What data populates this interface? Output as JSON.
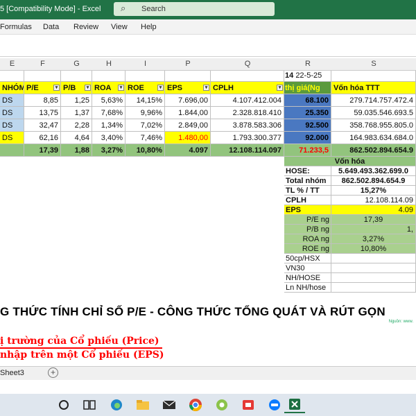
{
  "window": {
    "title": "5 [Compatibility Mode]  -  Excel",
    "search_placeholder": "Search"
  },
  "menu": [
    "Formulas",
    "Data",
    "Review",
    "View",
    "Help"
  ],
  "columns": [
    "E",
    "F",
    "G",
    "H",
    "I",
    "P",
    "Q",
    "R",
    "S"
  ],
  "top_row": {
    "num": "14",
    "date": "22-5-25"
  },
  "headers": [
    "NHÓM",
    "P/E",
    "P/B",
    "ROA",
    "ROE",
    "EPS",
    "CPLH",
    "thị giá(Ng",
    "Vốn hóa TTT"
  ],
  "rows": [
    [
      "DS",
      "8,85",
      "1,25",
      "5,63%",
      "14,15%",
      "7.696,00",
      "4.107.412.004",
      "68.100",
      "279.714.757.472.4"
    ],
    [
      "DS",
      "13,75",
      "1,37",
      "7,68%",
      "9,96%",
      "1.844,00",
      "2.328.818.410",
      "25.350",
      "59.035.546.693.5"
    ],
    [
      "DS",
      "32,47",
      "2,28",
      "1,34%",
      "7,02%",
      "2.849,00",
      "3.878.583.306",
      "92.500",
      "358.768.955.805.0"
    ],
    [
      "DS",
      "62,16",
      "4,64",
      "3,40%",
      "7,46%",
      "1.480,00",
      "1.793.300.377",
      "92.000",
      "164.983.634.684.0"
    ]
  ],
  "total_row": [
    "17,39",
    "1,88",
    "3,27%",
    "10,80%",
    "4.097",
    "12.108.114.097",
    "71.233,5",
    "862.502.894.654.9"
  ],
  "summary": {
    "header": "Vốn hóa",
    "items": [
      {
        "label": "HOSE:",
        "value": "5.649.493.362.699.0"
      },
      {
        "label": "Total nhóm",
        "value": "862.502.894.654.9"
      },
      {
        "label": "TL % / TT",
        "value": "15,27%"
      },
      {
        "label": "CPLH",
        "value": "12.108.114.09"
      },
      {
        "label": "EPS",
        "value": "4.09"
      },
      {
        "label": "P/E ng",
        "value": "17,39"
      },
      {
        "label": "P/B ng",
        "value": "1,"
      },
      {
        "label": "ROA ng",
        "value": "3,27%"
      },
      {
        "label": "ROE ng",
        "value": "10,80%"
      },
      {
        "label": "50cp/HSX",
        "value": ""
      },
      {
        "label": "VN30",
        "value": ""
      },
      {
        "label": "NH/HOSE",
        "value": ""
      },
      {
        "label": "Ln NH/hose",
        "value": ""
      }
    ]
  },
  "heading": "G THỨC TÍNH CHỈ SỐ P/E - CÔNG THỨC TỔNG QUÁT VÀ RÚT GỌN",
  "source": "Nguồn: www.",
  "line1": "ị trường của Cổ phiếu (Price)",
  "line2": "nhập trên một Cổ phiếu (EPS)",
  "sheet_tab": "Sheet3",
  "add_sheet": "+"
}
